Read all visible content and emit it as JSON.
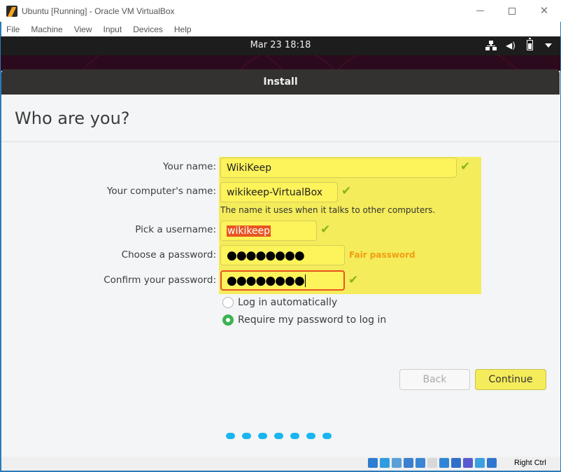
{
  "window": {
    "title": "Ubuntu [Running] - Oracle VM VirtualBox",
    "controls": {
      "minimize": "minimize",
      "maximize": "maximize",
      "close": "✕"
    }
  },
  "menubar": [
    "File",
    "Machine",
    "View",
    "Input",
    "Devices",
    "Help"
  ],
  "topbar": {
    "clock": "Mar 23  18:18",
    "tray_icons": [
      "network-icon",
      "volume-icon",
      "battery-icon",
      "system-menu-icon"
    ]
  },
  "installer": {
    "header": "Install",
    "page_title": "Who are you?",
    "fields": {
      "your_name": {
        "label": "Your name:",
        "value": "WikiKeep",
        "valid": true
      },
      "computer_name": {
        "label": "Your computer's name:",
        "value": "wikikeep-VirtualBox",
        "valid": true,
        "hint": "The name it uses when it talks to other computers."
      },
      "username": {
        "label": "Pick a username:",
        "value": "wikikeep",
        "valid": true,
        "selected": true
      },
      "password": {
        "label": "Choose a password:",
        "masked": "●●●●●●●●",
        "strength": "Fair password"
      },
      "confirm": {
        "label": "Confirm your password:",
        "masked": "●●●●●●●●",
        "valid": true,
        "focused": true
      }
    },
    "check_glyph": "✔",
    "login_options": [
      {
        "label": "Log in automatically",
        "selected": false
      },
      {
        "label": "Require my password to log in",
        "selected": true
      }
    ],
    "buttons": {
      "back": "Back",
      "continue": "Continue"
    },
    "progress_steps": 7
  },
  "statusbar": {
    "icons": [
      "hard-disk-icon",
      "optical-drive-icon",
      "audio-icon",
      "network-adapter-icon",
      "usb-icon",
      "shared-folders-icon",
      "display-icon",
      "capture-icon",
      "virtualization-icon",
      "mouse-integration-icon",
      "keyboard-icon"
    ],
    "host_key": "Right Ctrl"
  },
  "colors": {
    "accent": "#e95420",
    "highlight": "#f4ec5a",
    "valid_check": "#8ab31e",
    "strength_fair": "#f39c12",
    "progress_dot": "#19b6ee",
    "radio_on": "#3eb34f"
  }
}
